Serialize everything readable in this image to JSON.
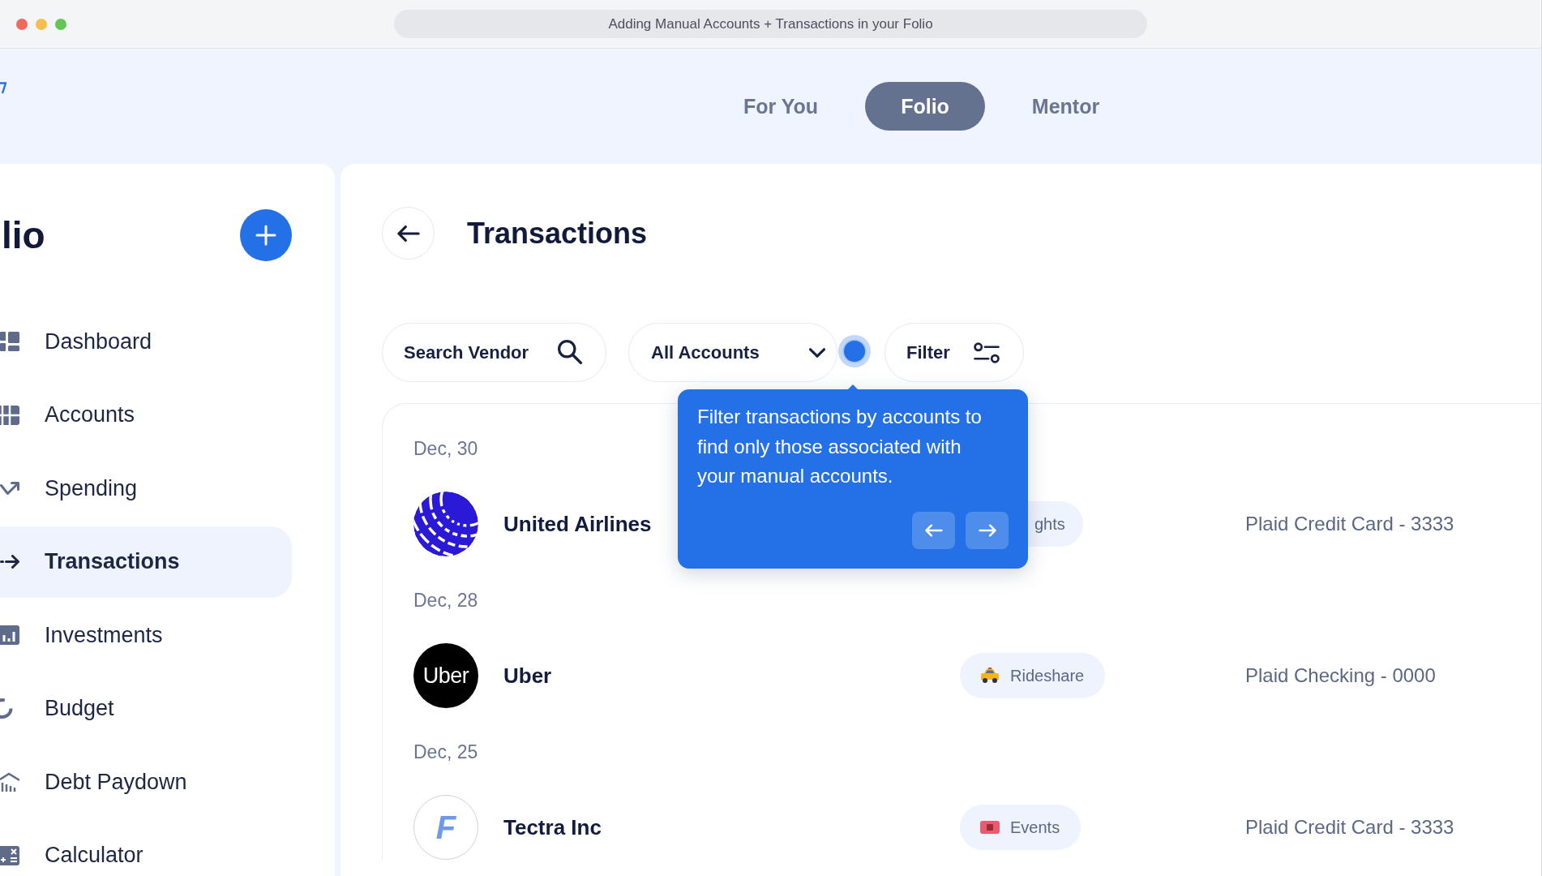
{
  "window": {
    "title": "Adding Manual Accounts + Transactions in your Folio"
  },
  "top_nav": {
    "tabs": [
      {
        "label": "For You",
        "selected": false
      },
      {
        "label": "Folio",
        "selected": true
      },
      {
        "label": "Mentor",
        "selected": false
      }
    ]
  },
  "sidebar": {
    "title": "lio",
    "items": [
      {
        "label": "Dashboard",
        "selected": false
      },
      {
        "label": "Accounts",
        "selected": false
      },
      {
        "label": "Spending",
        "selected": false
      },
      {
        "label": "Transactions",
        "selected": true
      },
      {
        "label": "Investments",
        "selected": false
      },
      {
        "label": "Budget",
        "selected": false
      },
      {
        "label": "Debt Paydown",
        "selected": false
      },
      {
        "label": "Calculator",
        "selected": false
      }
    ]
  },
  "page": {
    "title": "Transactions",
    "search": {
      "placeholder": "Search Vendor"
    },
    "account_filter": {
      "value": "All Accounts"
    },
    "filter_button": {
      "label": "Filter"
    },
    "groups": [
      {
        "date": "Dec, 30",
        "transactions": [
          {
            "vendor": "United Airlines",
            "logo": {
              "kind": "globe"
            },
            "category": "ghts",
            "account": "Plaid Credit Card - 3333"
          }
        ]
      },
      {
        "date": "Dec, 28",
        "transactions": [
          {
            "vendor": "Uber",
            "logo": {
              "kind": "wordmark",
              "text": "Uber"
            },
            "category": "Rideshare",
            "account": "Plaid Checking - 0000"
          }
        ]
      },
      {
        "date": "Dec, 25",
        "transactions": [
          {
            "vendor": "Tectra Inc",
            "logo": {
              "kind": "monogram",
              "text": "F"
            },
            "category": "Events",
            "account": "Plaid Credit Card - 3333"
          }
        ]
      }
    ]
  },
  "tooltip": {
    "text": "Filter transactions by accounts to find only those associated with your manual accounts."
  }
}
